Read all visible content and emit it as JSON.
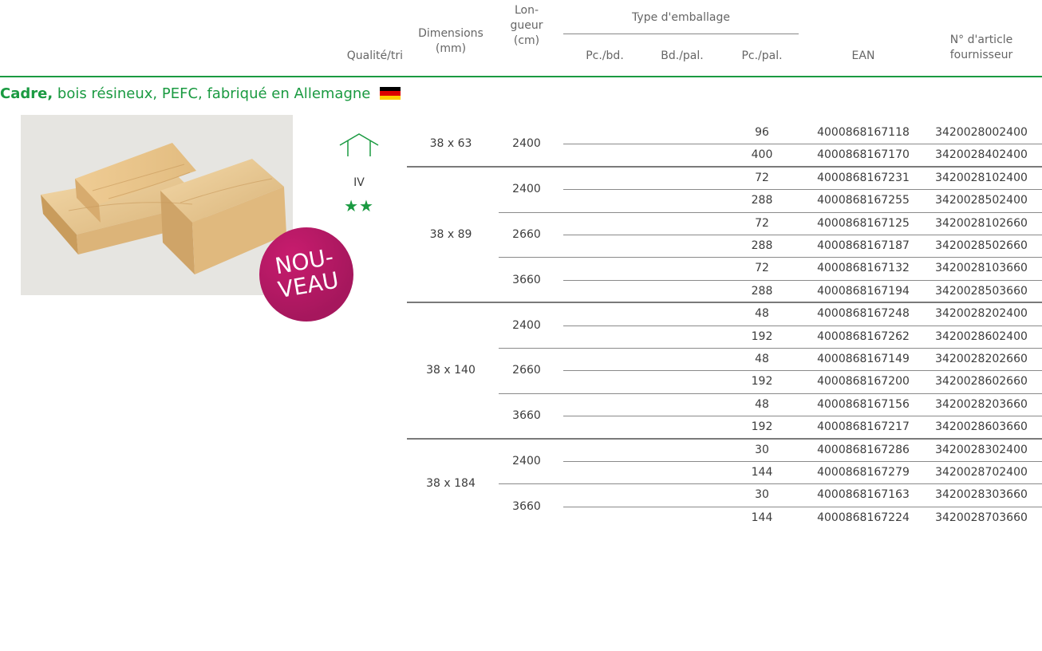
{
  "header": {
    "quality": "Qualité/tri",
    "dimensions": [
      "Dimensions",
      "(mm)"
    ],
    "length": [
      "Lon-",
      "gueur",
      "(cm)"
    ],
    "packaging_type": "Type d'emballage",
    "pc_bd": "Pc./bd.",
    "bd_pal": "Bd./pal.",
    "pc_pal": "Pc./pal.",
    "ean": "EAN",
    "supplier": [
      "N° d'article",
      "fournisseur"
    ]
  },
  "section": {
    "title_bold": "Cadre,",
    "title_rest": " bois résineux, PEFC, fabriqué en Allemagne",
    "flag_colors": [
      "#000000",
      "#dd0000",
      "#ffce00"
    ]
  },
  "product": {
    "image": "pine-lumber-planks-photo",
    "badge": [
      "NOU-",
      "VEAU"
    ],
    "quality_icon": "house-outline-icon",
    "quality_class": "IV",
    "stars": "★★"
  },
  "colors": {
    "accent_green": "#1a9a41",
    "badge_magenta": "#b01861"
  },
  "groups": [
    {
      "dim": "38 x 63",
      "lengths": [
        {
          "len": "2400",
          "rows": [
            {
              "pc_pal": "96",
              "ean": "4000868167118",
              "supplier": "3420028002400"
            },
            {
              "pc_pal": "400",
              "ean": "4000868167170",
              "supplier": "3420028402400"
            }
          ]
        }
      ]
    },
    {
      "dim": "38 x 89",
      "lengths": [
        {
          "len": "2400",
          "rows": [
            {
              "pc_pal": "72",
              "ean": "4000868167231",
              "supplier": "3420028102400"
            },
            {
              "pc_pal": "288",
              "ean": "4000868167255",
              "supplier": "3420028502400"
            }
          ]
        },
        {
          "len": "2660",
          "rows": [
            {
              "pc_pal": "72",
              "ean": "4000868167125",
              "supplier": "3420028102660"
            },
            {
              "pc_pal": "288",
              "ean": "4000868167187",
              "supplier": "3420028502660"
            }
          ]
        },
        {
          "len": "3660",
          "rows": [
            {
              "pc_pal": "72",
              "ean": "4000868167132",
              "supplier": "3420028103660"
            },
            {
              "pc_pal": "288",
              "ean": "4000868167194",
              "supplier": "3420028503660"
            }
          ]
        }
      ]
    },
    {
      "dim": "38 x 140",
      "lengths": [
        {
          "len": "2400",
          "rows": [
            {
              "pc_pal": "48",
              "ean": "4000868167248",
              "supplier": "3420028202400"
            },
            {
              "pc_pal": "192",
              "ean": "4000868167262",
              "supplier": "3420028602400"
            }
          ]
        },
        {
          "len": "2660",
          "rows": [
            {
              "pc_pal": "48",
              "ean": "4000868167149",
              "supplier": "3420028202660"
            },
            {
              "pc_pal": "192",
              "ean": "4000868167200",
              "supplier": "3420028602660"
            }
          ]
        },
        {
          "len": "3660",
          "rows": [
            {
              "pc_pal": "48",
              "ean": "4000868167156",
              "supplier": "3420028203660"
            },
            {
              "pc_pal": "192",
              "ean": "4000868167217",
              "supplier": "3420028603660"
            }
          ]
        }
      ]
    },
    {
      "dim": "38 x 184",
      "lengths": [
        {
          "len": "2400",
          "rows": [
            {
              "pc_pal": "30",
              "ean": "4000868167286",
              "supplier": "3420028302400"
            },
            {
              "pc_pal": "144",
              "ean": "4000868167279",
              "supplier": "3420028702400"
            }
          ]
        },
        {
          "len": "3660",
          "rows": [
            {
              "pc_pal": "30",
              "ean": "4000868167163",
              "supplier": "3420028303660"
            },
            {
              "pc_pal": "144",
              "ean": "4000868167224",
              "supplier": "3420028703660"
            }
          ]
        }
      ]
    }
  ]
}
